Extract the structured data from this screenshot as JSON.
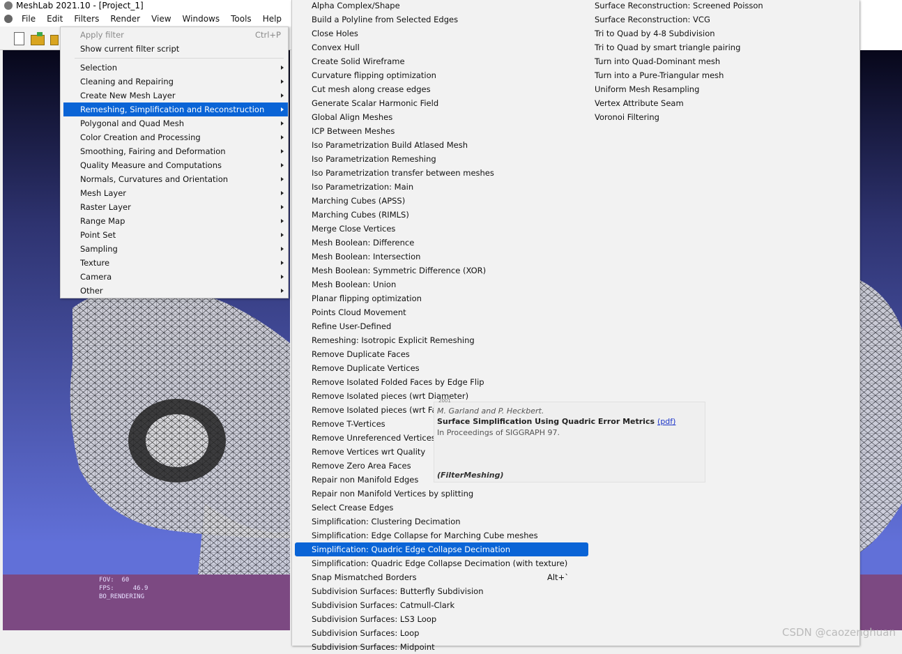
{
  "window": {
    "title": "MeshLab 2021.10 - [Project_1]",
    "menubar": [
      "File",
      "Edit",
      "Filters",
      "Render",
      "View",
      "Windows",
      "Tools",
      "Help"
    ]
  },
  "toolbar": {
    "icons": [
      "new-document-icon",
      "open-folder-icon",
      "import-mesh-icon"
    ]
  },
  "filters_menu": {
    "apply_filter": {
      "label": "Apply filter",
      "shortcut": "Ctrl+P",
      "enabled": false
    },
    "show_script": "Show current filter script",
    "categories": [
      "Selection",
      "Cleaning and Repairing",
      "Create New Mesh Layer",
      "Remeshing, Simplification and Reconstruction",
      "Polygonal and Quad Mesh",
      "Color Creation and Processing",
      "Smoothing, Fairing and Deformation",
      "Quality Measure and Computations",
      "Normals, Curvatures and Orientation",
      "Mesh Layer",
      "Raster Layer",
      "Range Map",
      "Point Set",
      "Sampling",
      "Texture",
      "Camera",
      "Other"
    ],
    "highlighted_category": "Remeshing, Simplification and Reconstruction"
  },
  "submenu": {
    "column1": [
      "Alpha Complex/Shape",
      "Build a Polyline from Selected Edges",
      "Close Holes",
      "Convex Hull",
      "Create Solid Wireframe",
      "Curvature flipping optimization",
      "Cut mesh along crease edges",
      "Generate Scalar Harmonic Field",
      "Global Align Meshes",
      "ICP Between Meshes",
      "Iso Parametrization Build Atlased Mesh",
      "Iso Parametrization Remeshing",
      "Iso Parametrization transfer between meshes",
      "Iso Parametrization: Main",
      "Marching Cubes (APSS)",
      "Marching Cubes (RIMLS)",
      "Merge Close Vertices",
      "Mesh Boolean: Difference",
      "Mesh Boolean: Intersection",
      "Mesh Boolean: Symmetric Difference (XOR)",
      "Mesh Boolean: Union",
      "Planar flipping optimization",
      "Points Cloud Movement",
      "Refine User-Defined",
      "Remeshing: Isotropic Explicit Remeshing",
      "Remove Duplicate Faces",
      "Remove Duplicate Vertices",
      "Remove Isolated Folded Faces by Edge Flip",
      "Remove Isolated pieces (wrt Diameter)",
      "Remove Isolated pieces (wrt Face",
      "Remove T-Vertices",
      "Remove Unreferenced Vertices",
      "Remove Vertices wrt Quality",
      "Remove Zero Area Faces",
      "Repair non Manifold Edges",
      "Repair non Manifold Vertices by splitting",
      "Select Crease Edges",
      "Simplification: Clustering Decimation",
      "Simplification: Edge Collapse for Marching Cube meshes",
      "Simplification: Quadric Edge Collapse Decimation",
      "Simplification: Quadric Edge Collapse Decimation (with texture)",
      "Snap Mismatched Borders",
      "Subdivision Surfaces: Butterfly Subdivision",
      "Subdivision Surfaces: Catmull-Clark",
      "Subdivision Surfaces: LS3 Loop",
      "Subdivision Surfaces: Loop",
      "Subdivision Surfaces: Midpoint"
    ],
    "highlighted_item": "Simplification: Quadric Edge Collapse Decimation",
    "snap_shortcut": "Alt+`",
    "column2": [
      "Surface Reconstruction: Screened Poisson",
      "Surface Reconstruction: VCG",
      "Tri to Quad by 4-8 Subdivision",
      "Tri to Quad by smart triangle pairing",
      "Turn into Quad-Dominant mesh",
      "Turn into a Pure-Triangular mesh",
      "Uniform Mesh Resampling",
      "Vertex Attribute Seam",
      "Voronoi Filtering"
    ]
  },
  "tooltip": {
    "year": "2001",
    "authors": "M. Garland and P. Heckbert.",
    "paper_title": "Surface Simplification Using Quadric Error Metrics",
    "pdf_link": "(pdf)",
    "proceedings": "In Proceedings of SIGGRAPH 97.",
    "plugin": "(FilterMeshing)"
  },
  "hud": {
    "fov": "FOV:  60",
    "fps": "FPS:     46.9",
    "render_mode": "BO_RENDERING"
  },
  "colors": {
    "menu_highlight": "#0a64d6",
    "viewport_top": "#07071a",
    "viewport_bottom": "#6170d8",
    "info_band": "#7c4982"
  },
  "watermark": "CSDN @caozenghuan"
}
